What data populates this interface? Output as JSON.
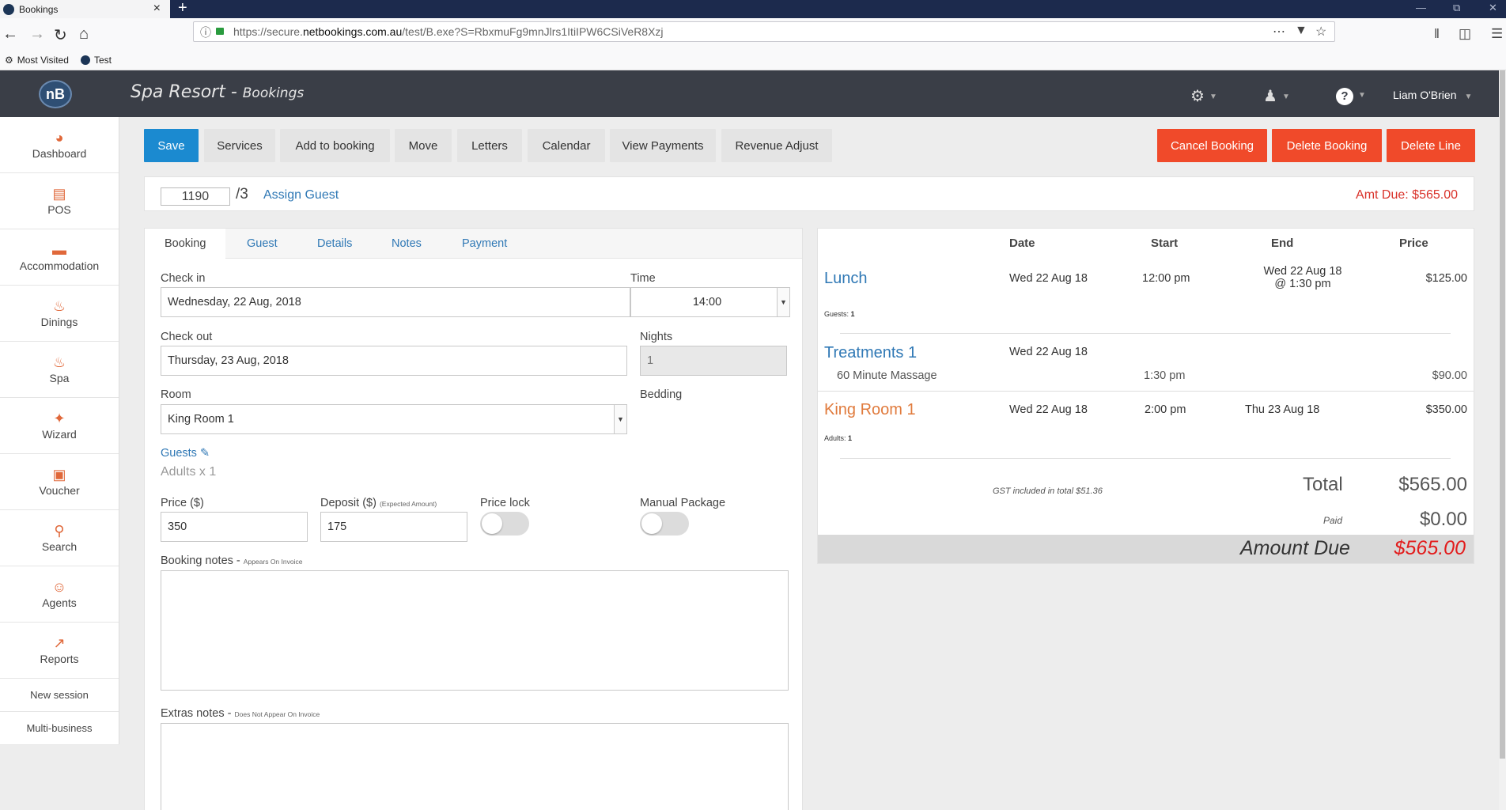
{
  "browser": {
    "tab_title": "Bookings",
    "new_tab": "+",
    "close_tab": "×",
    "url_prefix": "https://secure.",
    "url_domain": "netbookings.com.au",
    "url_suffix": "/test/B.exe?S=RbxmuFg9mnJlrs1ItiIPW6CSiVeR8Xzj",
    "bookmarks": [
      "Most Visited",
      "Test"
    ]
  },
  "app": {
    "title": "Spa Resort",
    "subtitle": "Bookings",
    "logo": "nB",
    "user": "Liam O'Brien"
  },
  "sidebar": {
    "items": [
      {
        "label": "Dashboard",
        "icon": "dashboard-icon"
      },
      {
        "label": "POS",
        "icon": "pos-icon"
      },
      {
        "label": "Accommodation",
        "icon": "bed-icon"
      },
      {
        "label": "Dinings",
        "icon": "dining-icon"
      },
      {
        "label": "Spa",
        "icon": "spa-icon"
      },
      {
        "label": "Wizard",
        "icon": "wand-icon"
      },
      {
        "label": "Voucher",
        "icon": "gift-icon"
      },
      {
        "label": "Search",
        "icon": "search-icon"
      },
      {
        "label": "Agents",
        "icon": "agent-icon"
      },
      {
        "label": "Reports",
        "icon": "chart-icon"
      }
    ],
    "new_session": "New session",
    "multi_business": "Multi-business"
  },
  "actions": {
    "save": "Save",
    "services": "Services",
    "add_to_booking": "Add to booking",
    "move": "Move",
    "letters": "Letters",
    "calendar": "Calendar",
    "view_payments": "View Payments",
    "revenue_adjust": "Revenue Adjust",
    "cancel_booking": "Cancel Booking",
    "delete_booking": "Delete Booking",
    "delete_line": "Delete Line"
  },
  "booking": {
    "number": "1190",
    "suffix": "/3",
    "assign_guest": "Assign Guest",
    "amount_due_label": "Amt Due: $565.00"
  },
  "tabs": [
    "Booking",
    "Guest",
    "Details",
    "Notes",
    "Payment"
  ],
  "form": {
    "check_in_label": "Check in",
    "check_in": "Wednesday, 22 Aug, 2018",
    "time_label": "Time",
    "time": "14:00",
    "check_out_label": "Check out",
    "check_out": "Thursday, 23 Aug, 2018",
    "nights_label": "Nights",
    "nights": "1",
    "room_label": "Room",
    "room": "King Room 1",
    "bedding_label": "Bedding",
    "guests_link": "Guests",
    "adults": "Adults x 1",
    "price_label": "Price ($)",
    "price": "350",
    "deposit_label": "Deposit ($)",
    "deposit_hint": "(Expected Amount)",
    "deposit": "175",
    "price_lock_label": "Price lock",
    "manual_package_label": "Manual Package",
    "booking_notes_label": "Booking notes - ",
    "booking_notes_hint": "Appears On Invoice",
    "extras_notes_label": "Extras notes - ",
    "extras_notes_hint": "Does Not Appear On Invoice"
  },
  "summary": {
    "headers": [
      "Date",
      "Start",
      "End",
      "Price"
    ],
    "lunch": {
      "title": "Lunch",
      "date": "Wed 22 Aug 18",
      "start": "12:00 pm",
      "end_line1": "Wed 22 Aug 18",
      "end_line2": "@ 1:30 pm",
      "price": "$125.00",
      "meta_label": "Guests: ",
      "meta_value": "1"
    },
    "treatments": {
      "title": "Treatments 1",
      "date": "Wed 22 Aug 18",
      "sub": "60 Minute Massage",
      "start": "1:30 pm",
      "price": "$90.00"
    },
    "room": {
      "title": "King Room 1",
      "date": "Wed 22 Aug 18",
      "start": "2:00 pm",
      "end": "Thu 23 Aug 18",
      "price": "$350.00",
      "meta_label": "Adults: ",
      "meta_value": "1"
    },
    "gst": "GST included in total $51.36",
    "total_label": "Total",
    "total": "$565.00",
    "paid_label": "Paid",
    "paid": "$0.00",
    "due_label": "Amount Due",
    "due": "$565.00"
  }
}
